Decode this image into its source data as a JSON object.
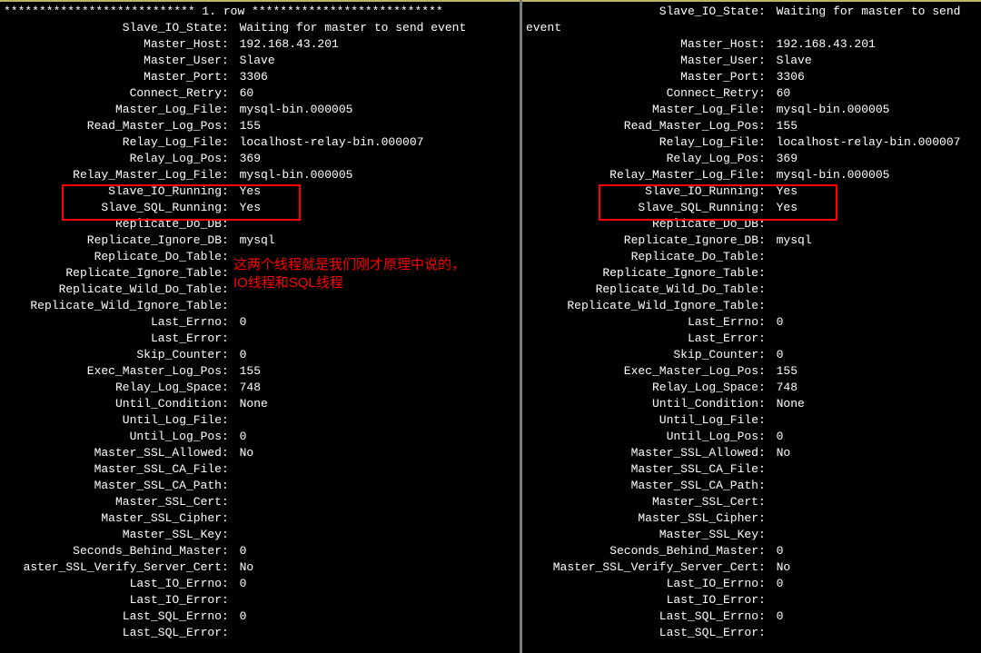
{
  "left": {
    "header": "*************************** 1. row ***************************",
    "rows": [
      {
        "k": "Slave_IO_State",
        "v": "Waiting for master to send event"
      },
      {
        "k": "Master_Host",
        "v": "192.168.43.201"
      },
      {
        "k": "Master_User",
        "v": "Slave"
      },
      {
        "k": "Master_Port",
        "v": "3306"
      },
      {
        "k": "Connect_Retry",
        "v": "60"
      },
      {
        "k": "Master_Log_File",
        "v": "mysql-bin.000005"
      },
      {
        "k": "Read_Master_Log_Pos",
        "v": "155"
      },
      {
        "k": "Relay_Log_File",
        "v": "localhost-relay-bin.000007"
      },
      {
        "k": "Relay_Log_Pos",
        "v": "369"
      },
      {
        "k": "Relay_Master_Log_File",
        "v": "mysql-bin.000005"
      },
      {
        "k": "Slave_IO_Running",
        "v": "Yes"
      },
      {
        "k": "Slave_SQL_Running",
        "v": "Yes"
      },
      {
        "k": "Replicate_Do_DB",
        "v": ""
      },
      {
        "k": "Replicate_Ignore_DB",
        "v": "mysql"
      },
      {
        "k": "Replicate_Do_Table",
        "v": ""
      },
      {
        "k": "Replicate_Ignore_Table",
        "v": ""
      },
      {
        "k": "Replicate_Wild_Do_Table",
        "v": ""
      },
      {
        "k": "Replicate_Wild_Ignore_Table",
        "v": ""
      },
      {
        "k": "Last_Errno",
        "v": "0"
      },
      {
        "k": "Last_Error",
        "v": ""
      },
      {
        "k": "Skip_Counter",
        "v": "0"
      },
      {
        "k": "Exec_Master_Log_Pos",
        "v": "155"
      },
      {
        "k": "Relay_Log_Space",
        "v": "748"
      },
      {
        "k": "Until_Condition",
        "v": "None"
      },
      {
        "k": "Until_Log_File",
        "v": ""
      },
      {
        "k": "Until_Log_Pos",
        "v": "0"
      },
      {
        "k": "Master_SSL_Allowed",
        "v": "No"
      },
      {
        "k": "Master_SSL_CA_File",
        "v": ""
      },
      {
        "k": "Master_SSL_CA_Path",
        "v": ""
      },
      {
        "k": "Master_SSL_Cert",
        "v": ""
      },
      {
        "k": "Master_SSL_Cipher",
        "v": ""
      },
      {
        "k": "Master_SSL_Key",
        "v": ""
      },
      {
        "k": "Seconds_Behind_Master",
        "v": "0"
      },
      {
        "k": "aster_SSL_Verify_Server_Cert",
        "v": "No",
        "trunc": true
      },
      {
        "k": "Last_IO_Errno",
        "v": "0"
      },
      {
        "k": "Last_IO_Error",
        "v": ""
      },
      {
        "k": "Last_SQL_Errno",
        "v": "0"
      },
      {
        "k": "Last_SQL_Error",
        "v": ""
      }
    ]
  },
  "right": {
    "wrapped_first": {
      "k": "Slave_IO_State",
      "v": "Waiting for master to send",
      "cont": "event"
    },
    "rows": [
      {
        "k": "Master_Host",
        "v": "192.168.43.201"
      },
      {
        "k": "Master_User",
        "v": "Slave"
      },
      {
        "k": "Master_Port",
        "v": "3306"
      },
      {
        "k": "Connect_Retry",
        "v": "60"
      },
      {
        "k": "Master_Log_File",
        "v": "mysql-bin.000005"
      },
      {
        "k": "Read_Master_Log_Pos",
        "v": "155"
      },
      {
        "k": "Relay_Log_File",
        "v": "localhost-relay-bin.000007"
      },
      {
        "k": "Relay_Log_Pos",
        "v": "369"
      },
      {
        "k": "Relay_Master_Log_File",
        "v": "mysql-bin.000005"
      },
      {
        "k": "Slave_IO_Running",
        "v": "Yes"
      },
      {
        "k": "Slave_SQL_Running",
        "v": "Yes"
      },
      {
        "k": "Replicate_Do_DB",
        "v": ""
      },
      {
        "k": "Replicate_Ignore_DB",
        "v": "mysql"
      },
      {
        "k": "Replicate_Do_Table",
        "v": ""
      },
      {
        "k": "Replicate_Ignore_Table",
        "v": ""
      },
      {
        "k": "Replicate_Wild_Do_Table",
        "v": ""
      },
      {
        "k": "Replicate_Wild_Ignore_Table",
        "v": ""
      },
      {
        "k": "Last_Errno",
        "v": "0"
      },
      {
        "k": "Last_Error",
        "v": ""
      },
      {
        "k": "Skip_Counter",
        "v": "0"
      },
      {
        "k": "Exec_Master_Log_Pos",
        "v": "155"
      },
      {
        "k": "Relay_Log_Space",
        "v": "748"
      },
      {
        "k": "Until_Condition",
        "v": "None"
      },
      {
        "k": "Until_Log_File",
        "v": ""
      },
      {
        "k": "Until_Log_Pos",
        "v": "0"
      },
      {
        "k": "Master_SSL_Allowed",
        "v": "No"
      },
      {
        "k": "Master_SSL_CA_File",
        "v": ""
      },
      {
        "k": "Master_SSL_CA_Path",
        "v": ""
      },
      {
        "k": "Master_SSL_Cert",
        "v": ""
      },
      {
        "k": "Master_SSL_Cipher",
        "v": ""
      },
      {
        "k": "Master_SSL_Key",
        "v": ""
      },
      {
        "k": "Seconds_Behind_Master",
        "v": "0"
      },
      {
        "k": "Master_SSL_Verify_Server_Cert",
        "v": "No"
      },
      {
        "k": "Last_IO_Errno",
        "v": "0"
      },
      {
        "k": "Last_IO_Error",
        "v": ""
      },
      {
        "k": "Last_SQL_Errno",
        "v": "0"
      },
      {
        "k": "Last_SQL_Error",
        "v": ""
      }
    ]
  },
  "annotation": {
    "line1": "这两个线程就是我们刚才原理中说的，",
    "line2": "IO线程和SQL线程"
  }
}
